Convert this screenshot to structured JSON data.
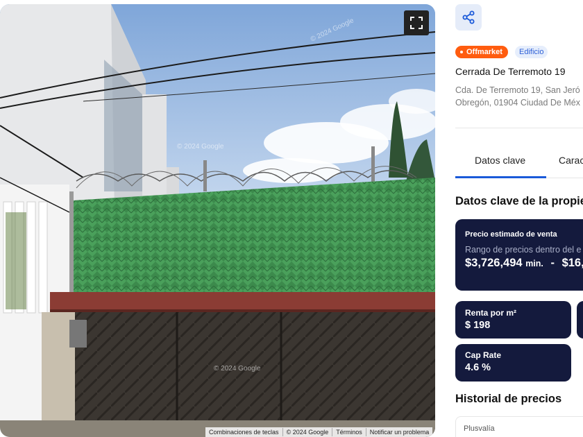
{
  "streetview": {
    "watermarks": [
      "© 2024 Google",
      "© 2024 Google",
      "© 2024 Google"
    ],
    "fullscreen_icon": "fullscreen-icon",
    "footer": [
      "Combinaciones de teclas",
      "© 2024 Google",
      "Términos",
      "Notificar un problema"
    ]
  },
  "property": {
    "share_icon": "share-icon",
    "badges": {
      "status": "Offmarket",
      "type": "Edificio"
    },
    "title": "Cerrada De Terremoto 19",
    "address_line1": "Cda. De Terremoto 19, San Jeró",
    "address_line2": "Obregón, 01904 Ciudad De Méx"
  },
  "tabs": [
    "Datos clave",
    "Caracte"
  ],
  "section_title": "Datos clave de la propie",
  "price_card": {
    "label": "Precio estimado de venta",
    "sub": "Rango de precios dentro del e",
    "min_value": "$3,726,494",
    "min_label": "min.",
    "separator": "-",
    "max_value": "$16,"
  },
  "metrics": [
    {
      "label": "Renta por m²",
      "value": "$ 198"
    },
    {
      "label": "Cap Rate",
      "value": "4.6 %"
    }
  ],
  "history_title": "Historial de precios",
  "history_card_label": "Plusvalía",
  "colors": {
    "accent": "#1a59d9",
    "badge_orange": "#ff5c0f",
    "card_navy": "#141a3d"
  }
}
